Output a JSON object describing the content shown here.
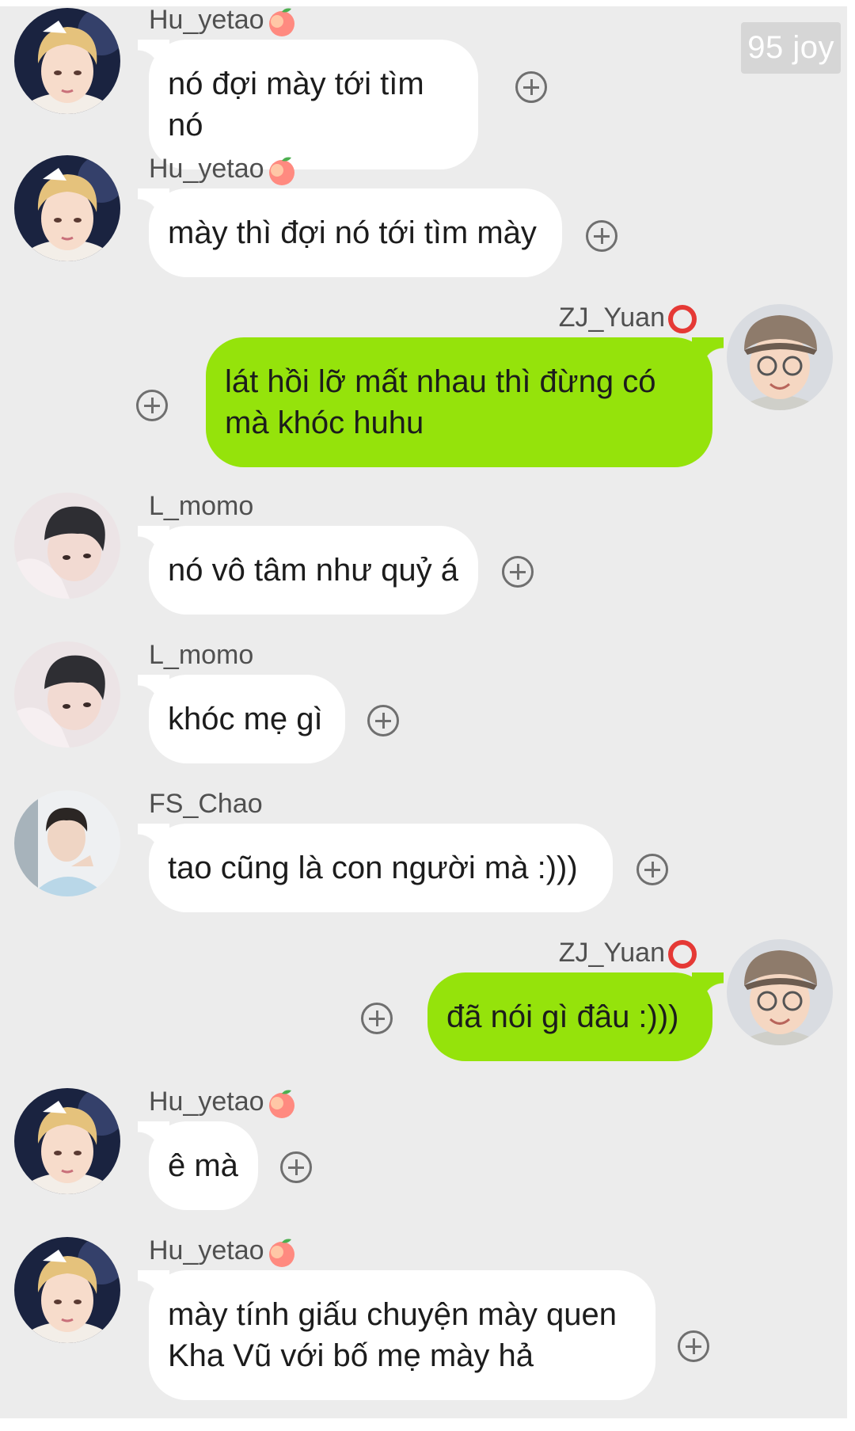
{
  "watermark": "95 joy",
  "users": {
    "hu": {
      "name": "Hu_yetao",
      "emoji": "peach-emoji",
      "side": "left"
    },
    "zj": {
      "name": "ZJ_Yuan",
      "emoji": "red-circle-emoji",
      "side": "right"
    },
    "lm": {
      "name": "L_momo",
      "emoji": "",
      "side": "left"
    },
    "fs": {
      "name": "FS_Chao",
      "emoji": "",
      "side": "left"
    }
  },
  "messages": [
    {
      "sender": "Hu_yetao",
      "text": "nó đợi mày tới tìm nó"
    },
    {
      "sender": "Hu_yetao",
      "text": "mày thì đợi nó tới tìm mày"
    },
    {
      "sender": "ZJ_Yuan",
      "text_line1": "lát hồi lỡ mất nhau thì đừng có",
      "text_line2": "mà khóc huhu"
    },
    {
      "sender": "L_momo",
      "text": "nó vô tâm như quỷ á"
    },
    {
      "sender": "L_momo",
      "text": "khóc mẹ gì"
    },
    {
      "sender": "FS_Chao",
      "text": "tao cũng là con người mà :)))"
    },
    {
      "sender": "ZJ_Yuan",
      "text": "đã nói gì đâu :)))"
    },
    {
      "sender": "Hu_yetao",
      "text": "ê mà"
    },
    {
      "sender": "Hu_yetao",
      "text_line1": "mày tính giấu chuyện mày quen",
      "text_line2": "Kha Vũ với bố mẹ mày hả"
    }
  ],
  "colors": {
    "background": "#ececec",
    "incoming_bubble": "#ffffff",
    "outgoing_bubble": "#95e30b",
    "text": "#1c1c1c",
    "name": "#505050"
  }
}
